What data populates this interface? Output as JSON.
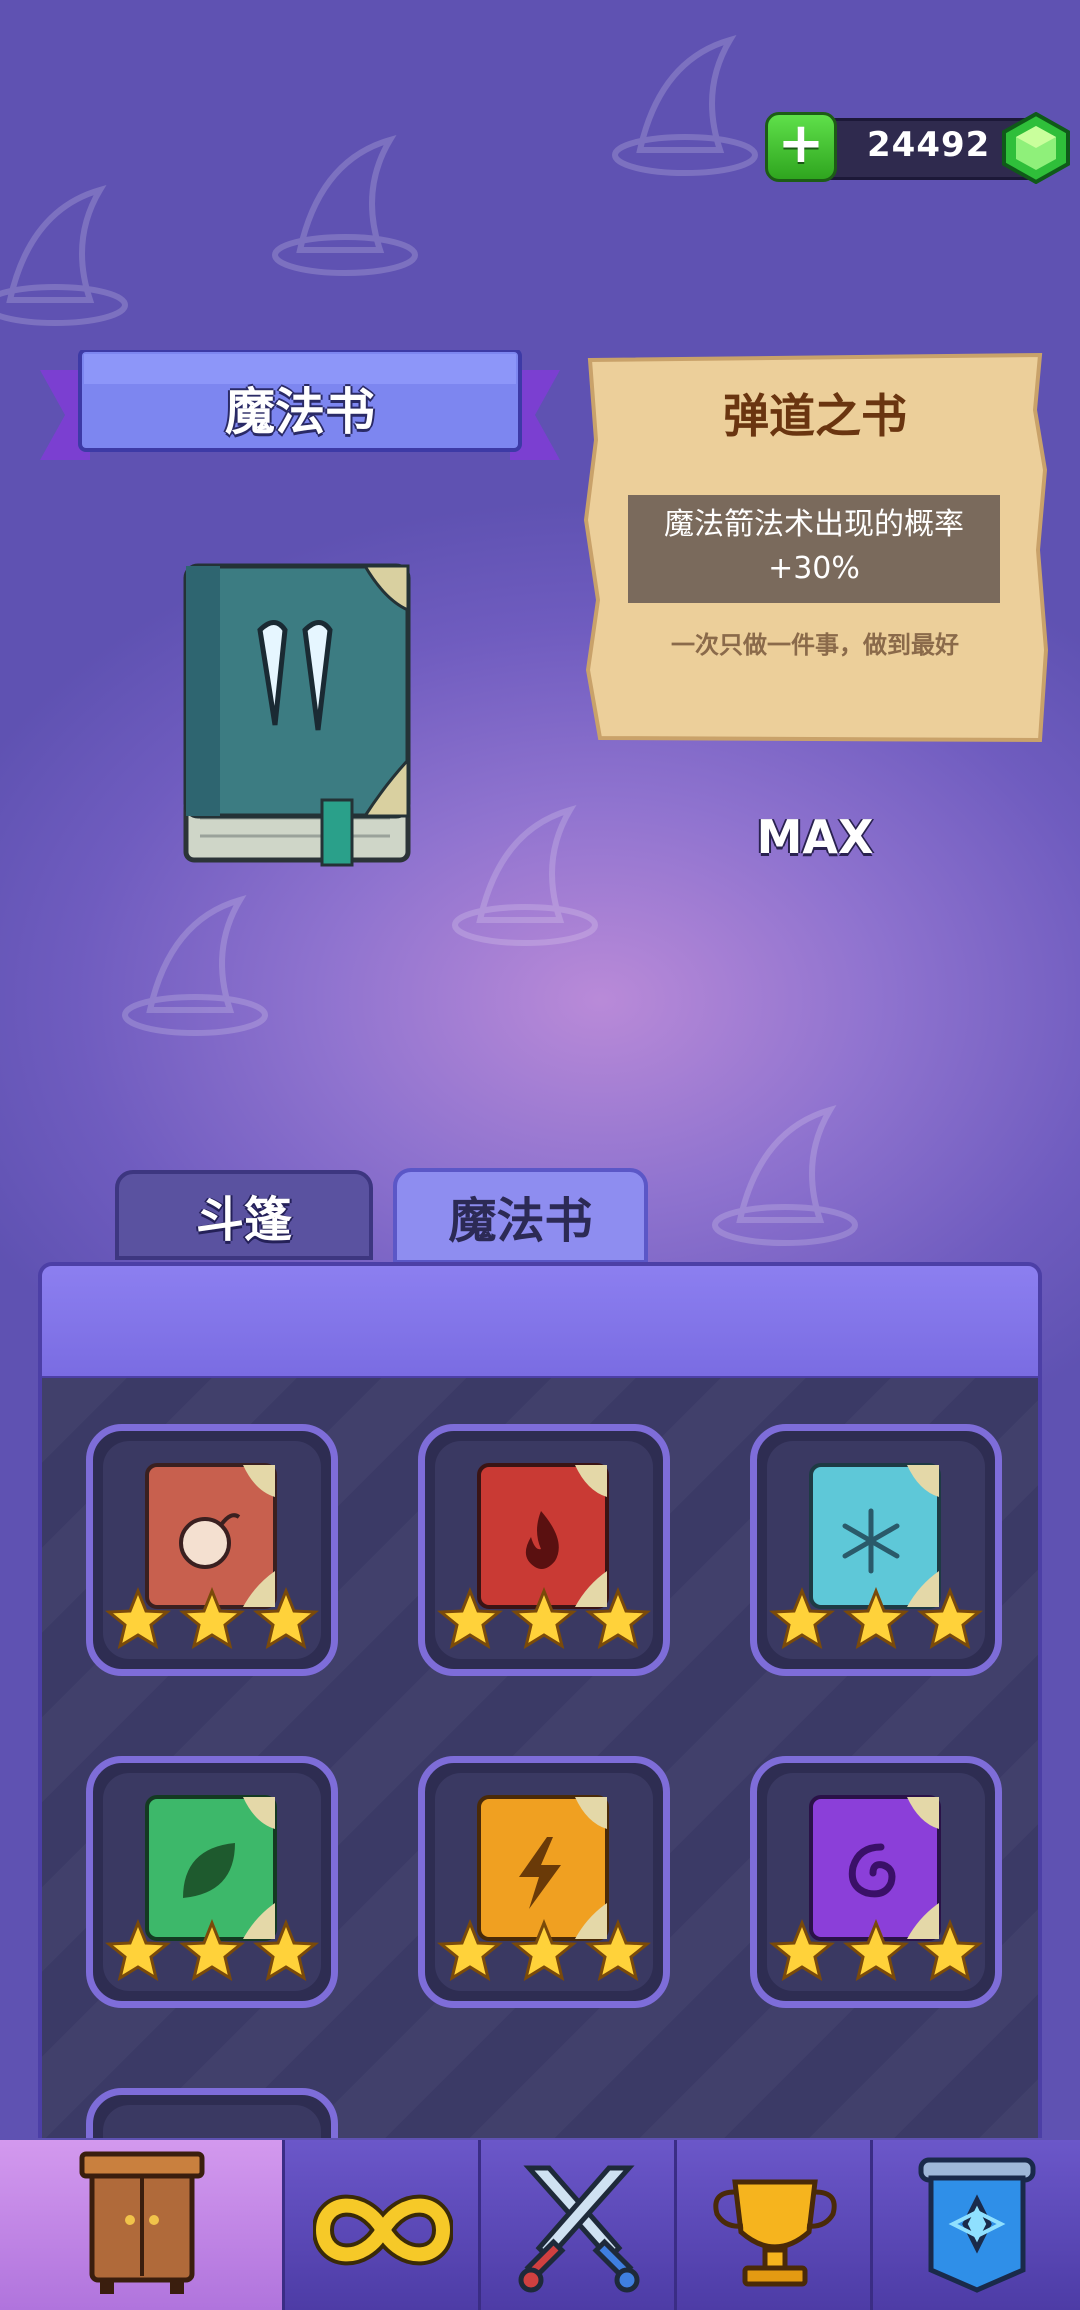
{
  "currency": {
    "gems": "24492",
    "add_icon": "plus-icon",
    "gem_icon": "green-gem-icon"
  },
  "header": {
    "ribbon_title": "魔法书"
  },
  "selected_book": {
    "name": "弹道之书",
    "effect_line1": "魔法箭法术出现的概率",
    "effect_line2": "+30%",
    "flavor": "一次只做一件事，做到最好",
    "level": "MAX",
    "icon": "icicle-book-icon"
  },
  "tabs": [
    {
      "label": "斗篷"
    },
    {
      "label": "魔法书"
    }
  ],
  "books": [
    {
      "icon": "bomb-book-icon",
      "color": "#c85a4a",
      "stars": 3
    },
    {
      "icon": "fire-book-icon",
      "color": "#c93a34",
      "stars": 3
    },
    {
      "icon": "snowflake-book-icon",
      "color": "#5ec8d8",
      "stars": 3
    },
    {
      "icon": "leaf-book-icon",
      "color": "#3db86a",
      "stars": 3
    },
    {
      "icon": "lightning-book-icon",
      "color": "#f0a021",
      "stars": 3
    },
    {
      "icon": "vortex-book-icon",
      "color": "#8b3fd9",
      "stars": 3
    }
  ],
  "nav": [
    {
      "icon": "wardrobe-icon",
      "active": true
    },
    {
      "icon": "infinity-icon",
      "active": false
    },
    {
      "icon": "crossed-swords-icon",
      "active": false
    },
    {
      "icon": "trophy-icon",
      "active": false
    },
    {
      "icon": "banner-icon",
      "active": false
    }
  ]
}
